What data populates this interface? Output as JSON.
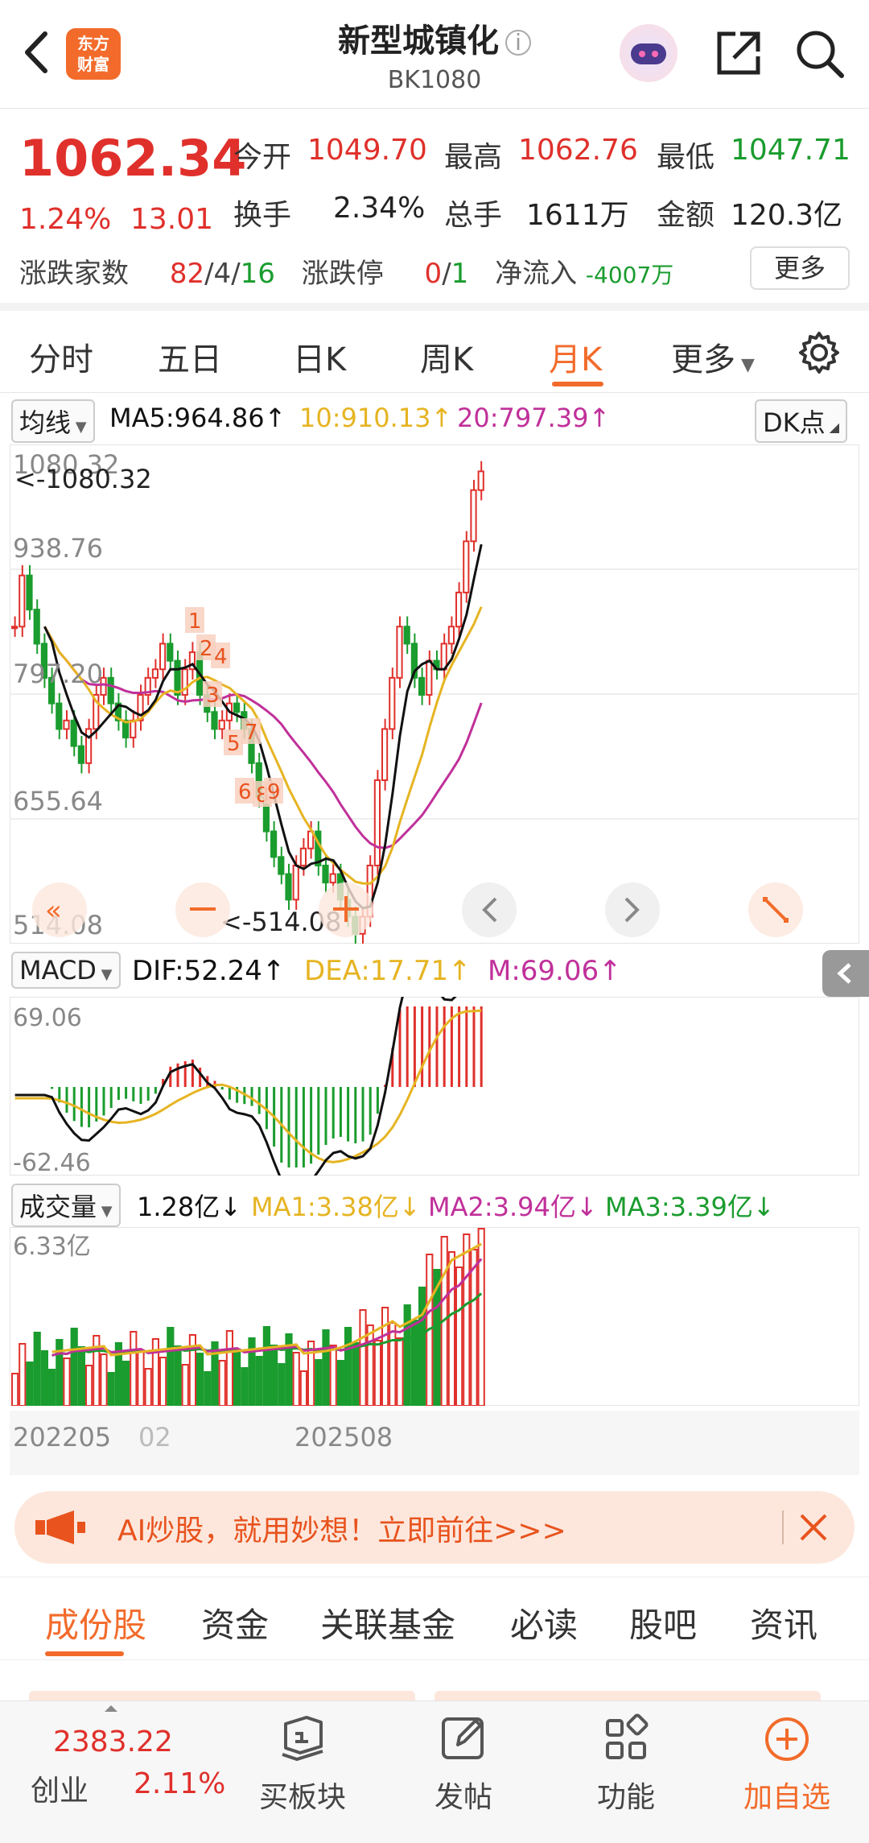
{
  "header": {
    "logo_text": "东方财富",
    "title": "新型城镇化",
    "info_icon": "ⓘ",
    "code": "BK1080"
  },
  "quote": {
    "price": "1062.34",
    "change_pct": "1.24%",
    "change": "13.01",
    "open_label": "今开",
    "open": "1049.70",
    "high_label": "最高",
    "high": "1062.76",
    "low_label": "最低",
    "low": "1047.71",
    "turnover_label": "换手",
    "turnover": "2.34%",
    "volume_label": "总手",
    "volume": "1611万",
    "amount_label": "金额",
    "amount": "120.3亿",
    "updown_label": "涨跌家数",
    "up_count": "82",
    "flat_count": "4",
    "down_count": "16",
    "limit_label": "涨跌停",
    "limit_up": "0",
    "limit_down": "1",
    "netflow_label": "净流入",
    "netflow": "-4007万",
    "more_label": "更多"
  },
  "tabs": [
    "分时",
    "五日",
    "日K",
    "周K",
    "月K",
    "更多"
  ],
  "active_tab": "月K",
  "ma_row": {
    "selector": "均线",
    "ma5": "MA5:964.86↑",
    "ma10": "10:910.13↑",
    "ma20": "20:797.39↑",
    "dk": "DK点"
  },
  "kchart": {
    "y_labels": [
      "1080.32",
      "938.76",
      "797.20",
      "655.64",
      "514.08"
    ],
    "max_marker": "<-1080.32",
    "min_marker": "<-514.08",
    "signal_numbers": [
      "1",
      "2",
      "4",
      "3",
      "5",
      "7",
      "6",
      "8",
      "9"
    ]
  },
  "macd_row": {
    "selector": "MACD",
    "dif": "DIF:52.24↑",
    "dea": "DEA:17.71↑",
    "m": "M:69.06↑",
    "y_top": "69.06",
    "y_bottom": "-62.46"
  },
  "vol_row": {
    "selector": "成交量",
    "vol": "1.28亿↓",
    "ma1": "MA1:3.38亿↓",
    "ma2": "MA2:3.94亿↓",
    "ma3": "MA3:3.39亿↓",
    "y_top": "6.33亿"
  },
  "dates": {
    "start": "202205",
    "start_suffix": "02",
    "mid": "202508"
  },
  "ad": {
    "text": "AI炒股，就用妙想！立即前往>>>"
  },
  "sub_tabs": [
    "成份股",
    "资金",
    "关联基金",
    "必读",
    "股吧",
    "资讯"
  ],
  "bottom_bar": {
    "index_value": "2383.22",
    "index_name": "创业",
    "index_pct": "2.11%",
    "buy_label": "买板块",
    "post_label": "发帖",
    "func_label": "功能",
    "add_label": "加自选"
  },
  "colors": {
    "accent": "#f26b2b",
    "up": "#e0302b",
    "down": "#1a9c2e",
    "ma5": "#111111",
    "ma10": "#e6b422",
    "ma20": "#c0309a"
  }
}
